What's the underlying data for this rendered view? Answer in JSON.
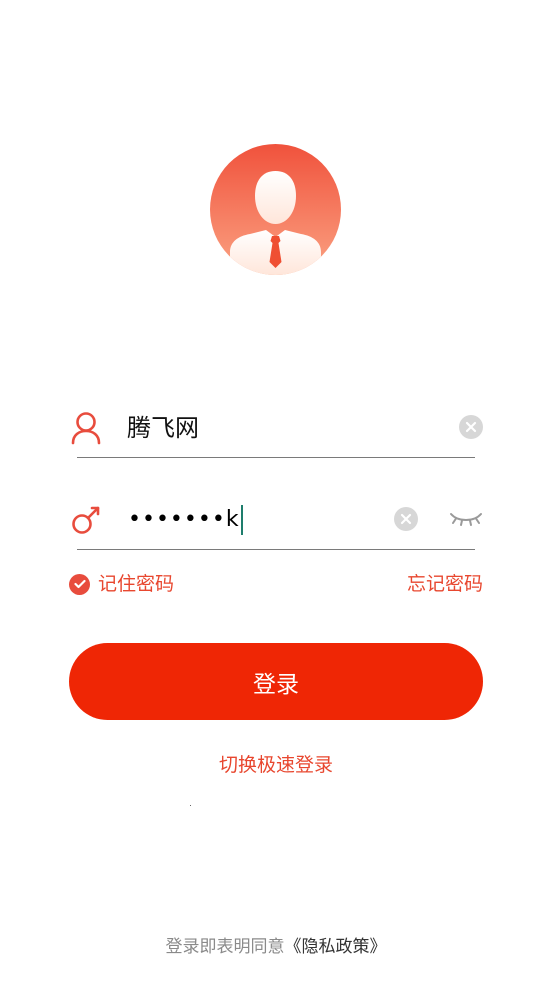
{
  "colors": {
    "accent": "#ef2605",
    "accent_text": "#e8472f",
    "avatar_top": "#f0523c",
    "avatar_bottom": "#fbb596"
  },
  "login_form": {
    "username": {
      "value": "腾飞网",
      "icon": "user-icon"
    },
    "password": {
      "masked_value": "•••••••k",
      "icon": "key-icon",
      "visibility_icon": "eye-closed-icon"
    },
    "remember_label": "记住密码",
    "remember_checked": true,
    "forgot_label": "忘记密码",
    "login_label": "登录",
    "switch_label": "切换极速登录"
  },
  "footer": {
    "text": "登录即表明同意",
    "link": "《隐私政策》"
  }
}
